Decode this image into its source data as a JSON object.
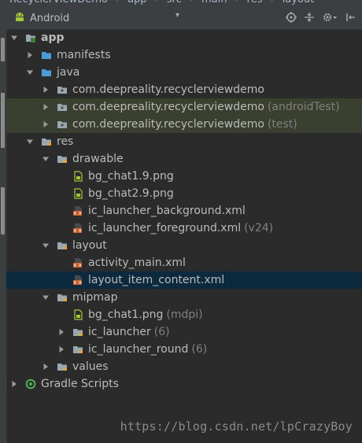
{
  "breadcrumb": [
    "RecyclerViewDemo",
    "app",
    "src",
    "main",
    "res",
    "layout"
  ],
  "toolbar": {
    "view_mode": "Android",
    "icons": [
      "sync-icon",
      "collapse-all-icon",
      "settings-icon",
      "hide-icon"
    ]
  },
  "tree": [
    {
      "name": "app-module",
      "label": "app",
      "suffix": "",
      "depth": 0,
      "arrow": "down",
      "icon": "module",
      "bold": true
    },
    {
      "name": "manifests-folder",
      "label": "manifests",
      "suffix": "",
      "depth": 1,
      "arrow": "right",
      "icon": "folder-blue"
    },
    {
      "name": "java-folder",
      "label": "java",
      "suffix": "",
      "depth": 1,
      "arrow": "down",
      "icon": "folder-blue"
    },
    {
      "name": "package-main",
      "label": "com.deepreality.recyclerviewdemo",
      "suffix": "",
      "depth": 2,
      "arrow": "right",
      "icon": "package"
    },
    {
      "name": "package-android-test",
      "label": "com.deepreality.recyclerviewdemo",
      "suffix": "(androidTest)",
      "depth": 2,
      "arrow": "right",
      "icon": "package",
      "test": true
    },
    {
      "name": "package-test",
      "label": "com.deepreality.recyclerviewdemo",
      "suffix": "(test)",
      "depth": 2,
      "arrow": "right",
      "icon": "package",
      "test": true
    },
    {
      "name": "res-folder",
      "label": "res",
      "suffix": "",
      "depth": 1,
      "arrow": "down",
      "icon": "folder-res"
    },
    {
      "name": "drawable-folder",
      "label": "drawable",
      "suffix": "",
      "depth": 2,
      "arrow": "down",
      "icon": "folder-res"
    },
    {
      "name": "bg-chat19-file",
      "label": "bg_chat1.9.png",
      "suffix": "",
      "depth": 3,
      "arrow": "none",
      "icon": "png"
    },
    {
      "name": "bg-chat29-file",
      "label": "bg_chat2.9.png",
      "suffix": "",
      "depth": 3,
      "arrow": "none",
      "icon": "png"
    },
    {
      "name": "ic-launcher-background-file",
      "label": "ic_launcher_background.xml",
      "suffix": "",
      "depth": 3,
      "arrow": "none",
      "icon": "xml"
    },
    {
      "name": "ic-launcher-foreground-file",
      "label": "ic_launcher_foreground.xml",
      "suffix": "(v24)",
      "depth": 3,
      "arrow": "none",
      "icon": "xml"
    },
    {
      "name": "layout-folder",
      "label": "layout",
      "suffix": "",
      "depth": 2,
      "arrow": "down",
      "icon": "folder-res"
    },
    {
      "name": "activity-main-file",
      "label": "activity_main.xml",
      "suffix": "",
      "depth": 3,
      "arrow": "none",
      "icon": "xml"
    },
    {
      "name": "layout-item-content-file",
      "label": "layout_item_content.xml",
      "suffix": "",
      "depth": 3,
      "arrow": "none",
      "icon": "xml",
      "selected": true
    },
    {
      "name": "mipmap-folder",
      "label": "mipmap",
      "suffix": "",
      "depth": 2,
      "arrow": "down",
      "icon": "folder-res"
    },
    {
      "name": "bg-chat1-file",
      "label": "bg_chat1.png",
      "suffix": "(mdpi)",
      "depth": 3,
      "arrow": "none",
      "icon": "png"
    },
    {
      "name": "ic-launcher-folder",
      "label": "ic_launcher",
      "suffix": "(6)",
      "depth": 3,
      "arrow": "right",
      "icon": "folder-res"
    },
    {
      "name": "ic-launcher-round-folder",
      "label": "ic_launcher_round",
      "suffix": "(6)",
      "depth": 3,
      "arrow": "right",
      "icon": "folder-res"
    },
    {
      "name": "values-folder",
      "label": "values",
      "suffix": "",
      "depth": 2,
      "arrow": "right",
      "icon": "folder-res"
    },
    {
      "name": "gradle-scripts",
      "label": "Gradle Scripts",
      "suffix": "",
      "depth": 0,
      "arrow": "right",
      "icon": "gradle"
    }
  ],
  "watermark": "https://blog.csdn.net/lpCrazyBoy",
  "colors": {
    "background": "#2b2b2b",
    "toolbar": "#3c3f41",
    "selected_row": "#0d293e",
    "test_row": "#39402f",
    "folder_blue": "#4a9bd6",
    "folder_gray": "#9aa7b0",
    "xml_orange": "#cc6633",
    "android_green": "#a4c639"
  }
}
